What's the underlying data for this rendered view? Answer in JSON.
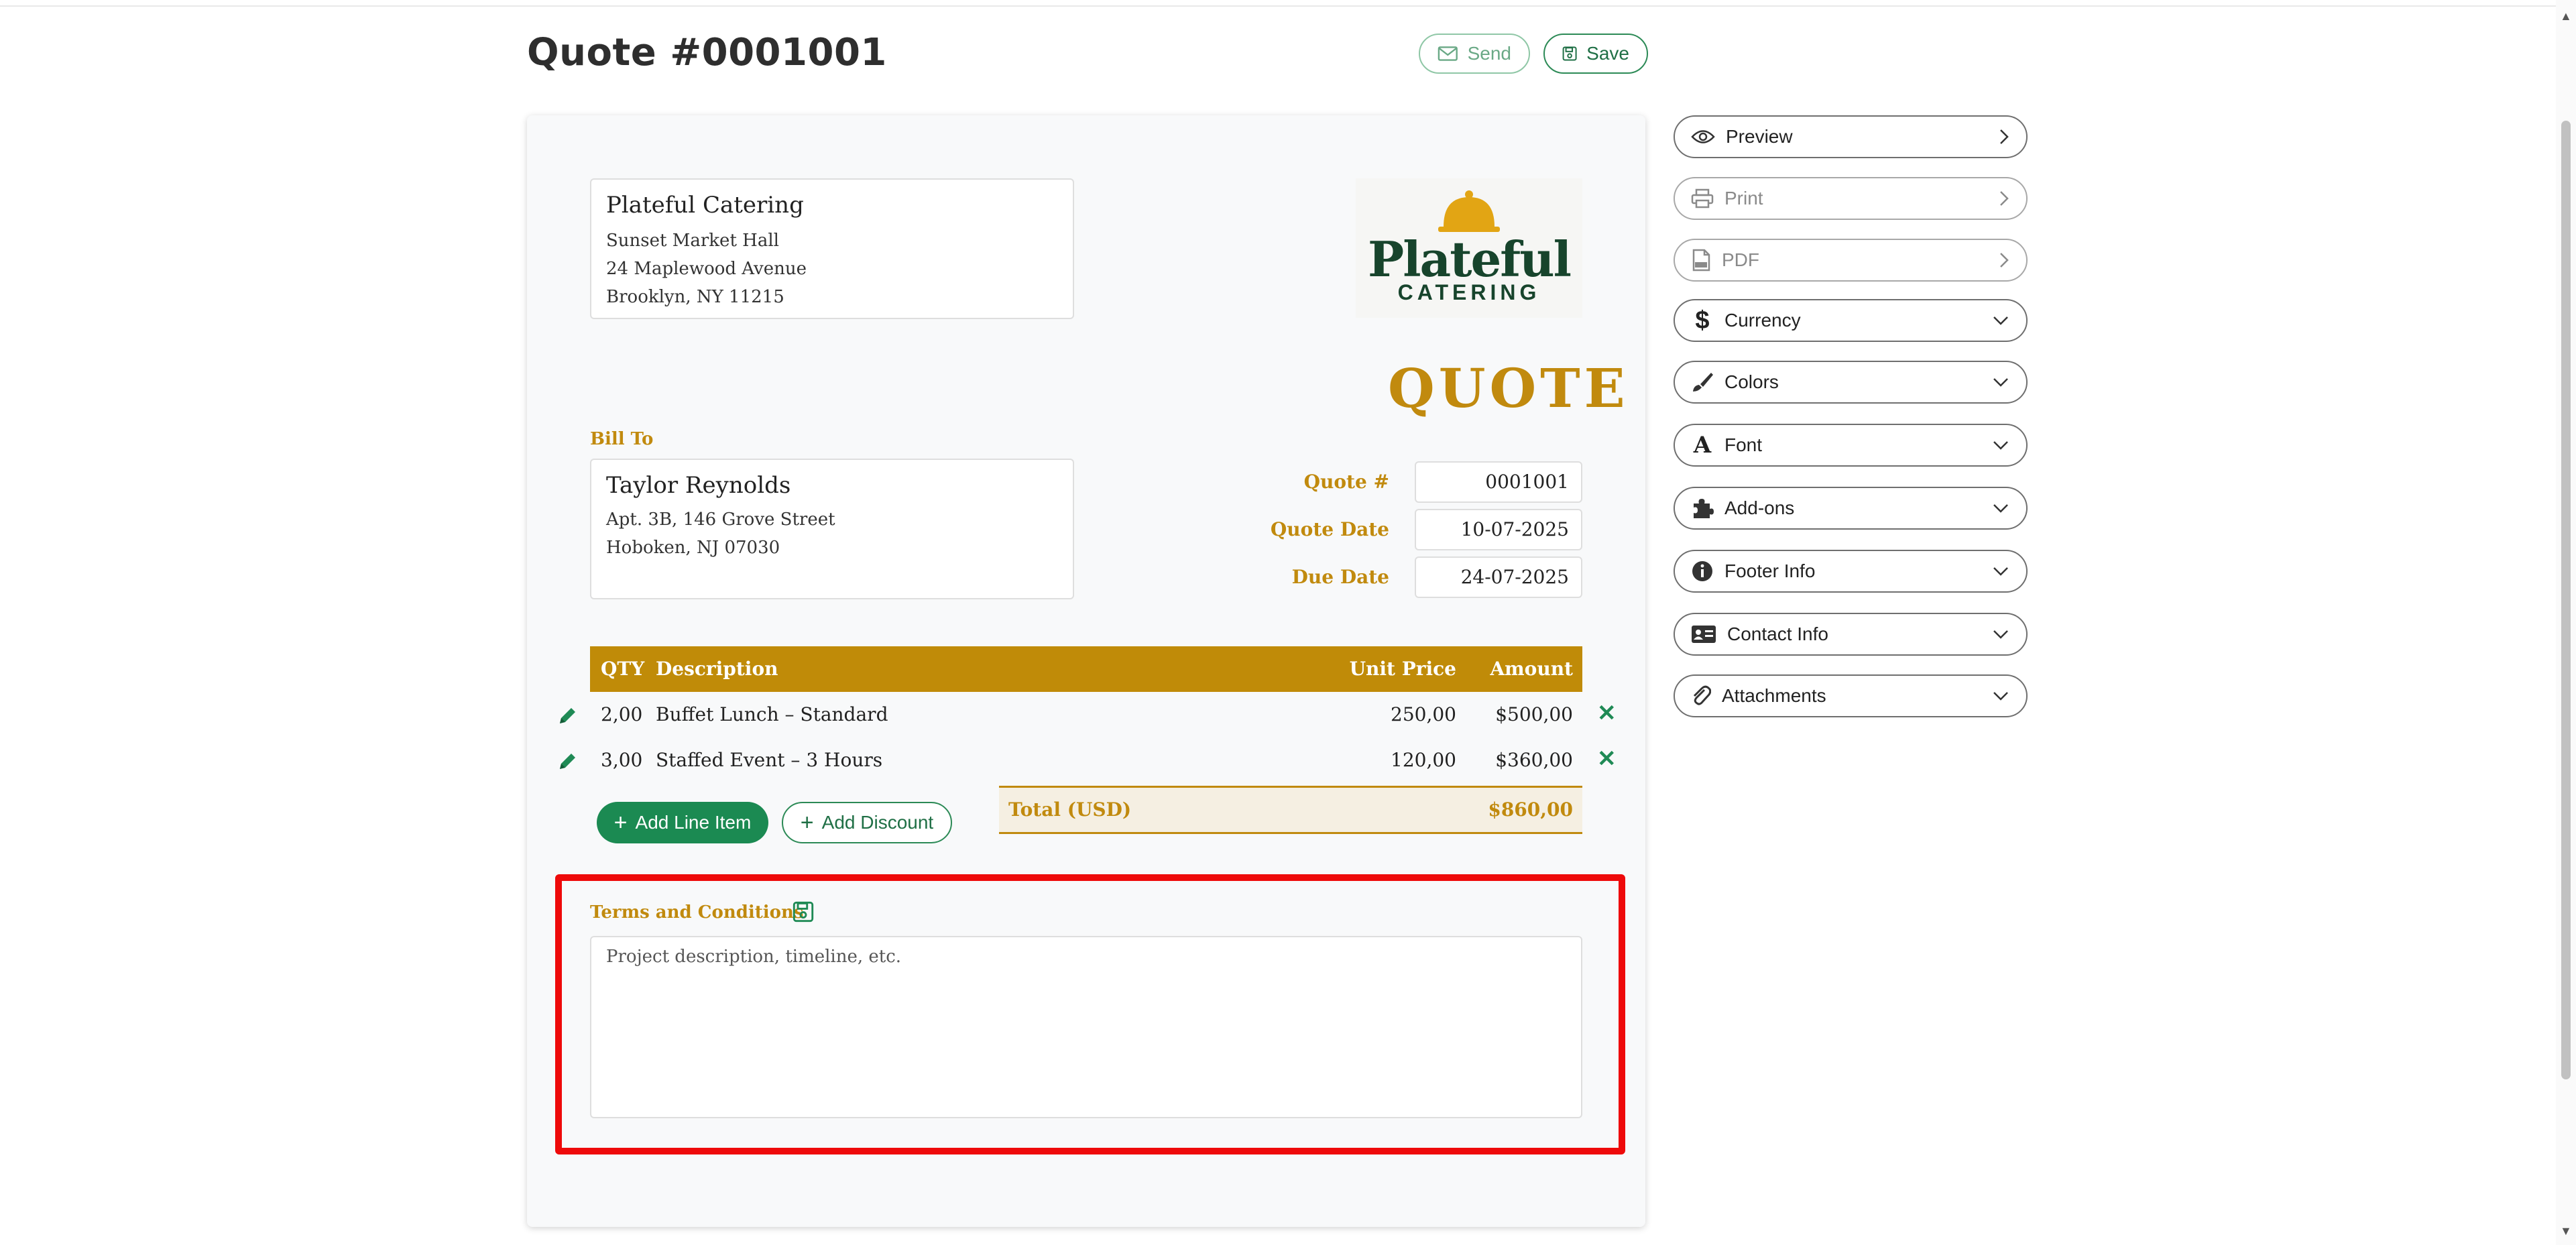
{
  "header": {
    "title": "Quote #0001001",
    "send_label": "Send",
    "save_label": "Save"
  },
  "from": {
    "name": "Plateful Catering",
    "lines": [
      "Sunset Market Hall",
      "24 Maplewood Avenue",
      "Brooklyn, NY 11215"
    ]
  },
  "logo": {
    "word": "Plateful",
    "sub": "CATERING"
  },
  "doc_type": "QUOTE",
  "bill_to": {
    "label": "Bill To",
    "name": "Taylor Reynolds",
    "lines": [
      "Apt. 3B, 146 Grove Street",
      "Hoboken, NJ 07030"
    ]
  },
  "meta": [
    {
      "label": "Quote #",
      "value": "0001001"
    },
    {
      "label": "Quote Date",
      "value": "10-07-2025"
    },
    {
      "label": "Due Date",
      "value": "24-07-2025"
    }
  ],
  "table": {
    "headers": {
      "qty": "QTY",
      "description": "Description",
      "unit_price": "Unit Price",
      "amount": "Amount"
    },
    "rows": [
      {
        "qty": "2,00",
        "description": "Buffet Lunch – Standard",
        "unit_price": "250,00",
        "amount": "$500,00"
      },
      {
        "qty": "3,00",
        "description": "Staffed Event – 3 Hours",
        "unit_price": "120,00",
        "amount": "$360,00"
      }
    ]
  },
  "actions": {
    "add_line_item": "Add Line Item",
    "add_discount": "Add Discount"
  },
  "total": {
    "label": "Total (USD)",
    "value": "$860,00"
  },
  "terms": {
    "label": "Terms and Conditions",
    "placeholder": "Project description, timeline, etc."
  },
  "sidebar": {
    "items": [
      {
        "label": "Preview",
        "icon": "eye-icon",
        "arrow": "chevron-right-icon"
      },
      {
        "label": "Print",
        "icon": "printer-icon",
        "arrow": "chevron-right-icon"
      },
      {
        "label": "PDF",
        "icon": "pdf-file-icon",
        "arrow": "chevron-right-icon"
      },
      {
        "label": "Currency",
        "icon": "dollar-icon",
        "arrow": "chevron-down-icon"
      },
      {
        "label": "Colors",
        "icon": "paintbrush-icon",
        "arrow": "chevron-down-icon"
      },
      {
        "label": "Font",
        "icon": "font-icon",
        "arrow": "chevron-down-icon"
      },
      {
        "label": "Add-ons",
        "icon": "puzzle-icon",
        "arrow": "chevron-down-icon"
      },
      {
        "label": "Footer Info",
        "icon": "info-icon",
        "arrow": "chevron-down-icon"
      },
      {
        "label": "Contact Info",
        "icon": "contact-card-icon",
        "arrow": "chevron-down-icon"
      },
      {
        "label": "Attachments",
        "icon": "paperclip-icon",
        "arrow": "chevron-down-icon"
      }
    ]
  },
  "colors": {
    "accent": "#c18a0e",
    "brand_green": "#1b8a52",
    "highlight": "#ee0a0a"
  }
}
